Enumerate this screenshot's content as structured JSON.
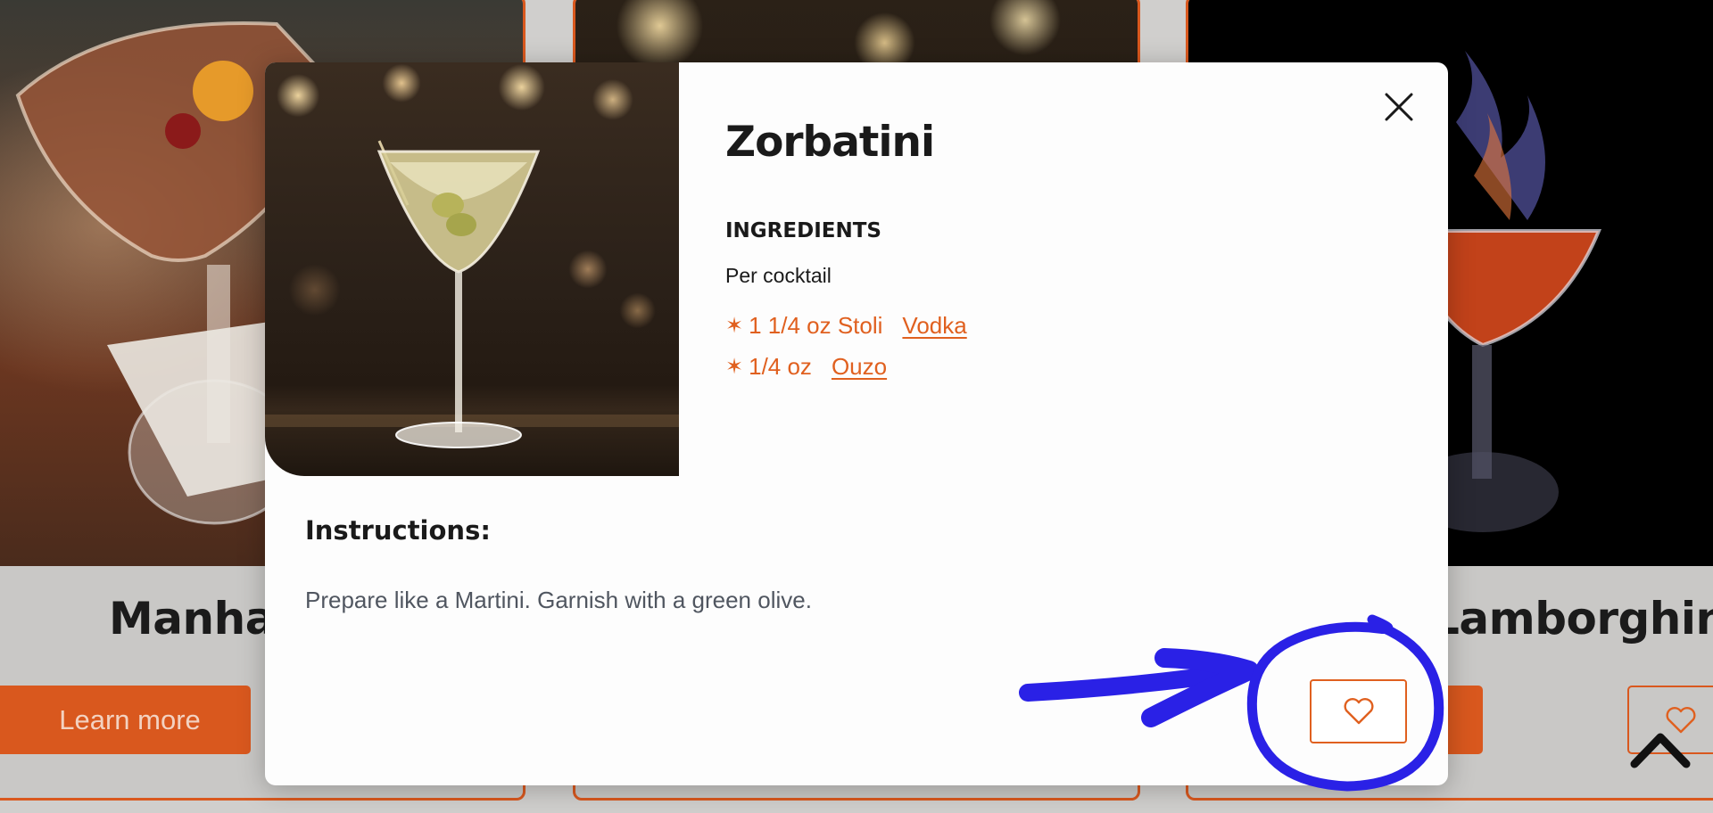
{
  "cards": [
    {
      "title": "Manhattan",
      "learn_more": "Learn more"
    },
    {
      "title": ""
    },
    {
      "title": "Lamborghini"
    }
  ],
  "modal": {
    "title": "Zorbatini",
    "ingredients_heading": "INGREDIENTS",
    "per_cocktail": "Per cocktail",
    "ingredients": [
      {
        "bullet": "✶",
        "amount": "1 1/4 oz Stoli",
        "link": "Vodka"
      },
      {
        "bullet": "✶",
        "amount": "1/4 oz",
        "link": "Ouzo"
      }
    ],
    "instructions_heading": "Instructions:",
    "instructions": "Prepare like a Martini. Garnish with a green olive.",
    "close_icon": "close-icon",
    "favorite_icon": "heart-icon"
  },
  "colors": {
    "accent": "#e0601f",
    "annotation": "#2a21e6",
    "backdrop": "#d0cfcd"
  }
}
